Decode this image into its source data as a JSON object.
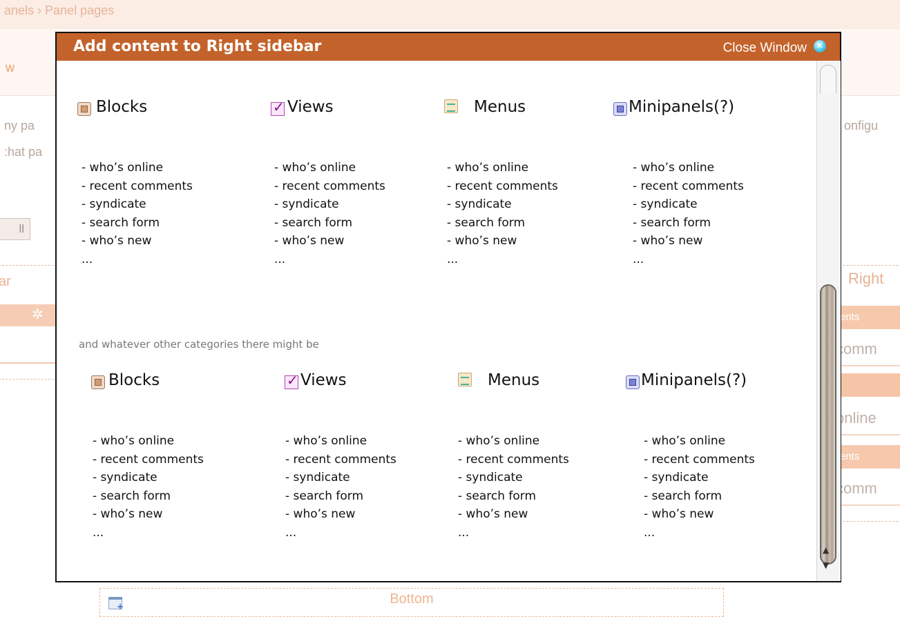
{
  "background": {
    "breadcrumb": "anels › Panel pages",
    "tab_fragment": "w",
    "text_line1": "ny pa",
    "text_line2": ":hat pa",
    "button_fragment": "ll",
    "left_region_label": "ar",
    "right_text": "onfigu",
    "right_region": {
      "title": "Right",
      "bar1": "ents",
      "text1": "comm",
      "text2": "bnline",
      "bar3": "ents",
      "text3": "comm"
    },
    "bottom_region_label": "Bottom"
  },
  "modal": {
    "title": "Add content to Right sidebar",
    "close_label": "Close Window",
    "note": "and whatever other categories there might be",
    "sections": [
      {
        "categories": [
          {
            "name": "Blocks",
            "icon": "block-icon",
            "items": [
              "- who’s online",
              "- recent comments",
              "- syndicate",
              "- search form",
              "- who’s new",
              "..."
            ]
          },
          {
            "name": "Views",
            "icon": "views-icon",
            "items": [
              "- who’s online",
              "- recent comments",
              "- syndicate",
              "- search form",
              "- who’s new",
              "..."
            ]
          },
          {
            "name": "Menus",
            "icon": "menus-icon",
            "items": [
              "- who’s online",
              "- recent comments",
              "- syndicate",
              "- search form",
              "- who’s new",
              "..."
            ]
          },
          {
            "name": "Minipanels(?)",
            "icon": "minipanels-icon",
            "items": [
              "- who’s online",
              "- recent comments",
              "- syndicate",
              "- search form",
              "- who’s new",
              "..."
            ]
          }
        ]
      },
      {
        "categories": [
          {
            "name": "Blocks",
            "icon": "block-icon",
            "items": [
              "- who’s online",
              "- recent comments",
              "- syndicate",
              "- search form",
              "- who’s new",
              "..."
            ]
          },
          {
            "name": "Views",
            "icon": "views-icon",
            "items": [
              "- who’s online",
              "- recent comments",
              "- syndicate",
              "- search form",
              "- who’s new",
              "..."
            ]
          },
          {
            "name": "Menus",
            "icon": "menus-icon",
            "items": [
              "- who’s online",
              "- recent comments",
              "- syndicate",
              "- search form",
              "- who’s new",
              "..."
            ]
          },
          {
            "name": "Minipanels(?)",
            "icon": "minipanels-icon",
            "items": [
              "- who’s online",
              "- recent comments",
              "- syndicate",
              "- search form",
              "- who’s new",
              "..."
            ]
          }
        ]
      }
    ]
  }
}
